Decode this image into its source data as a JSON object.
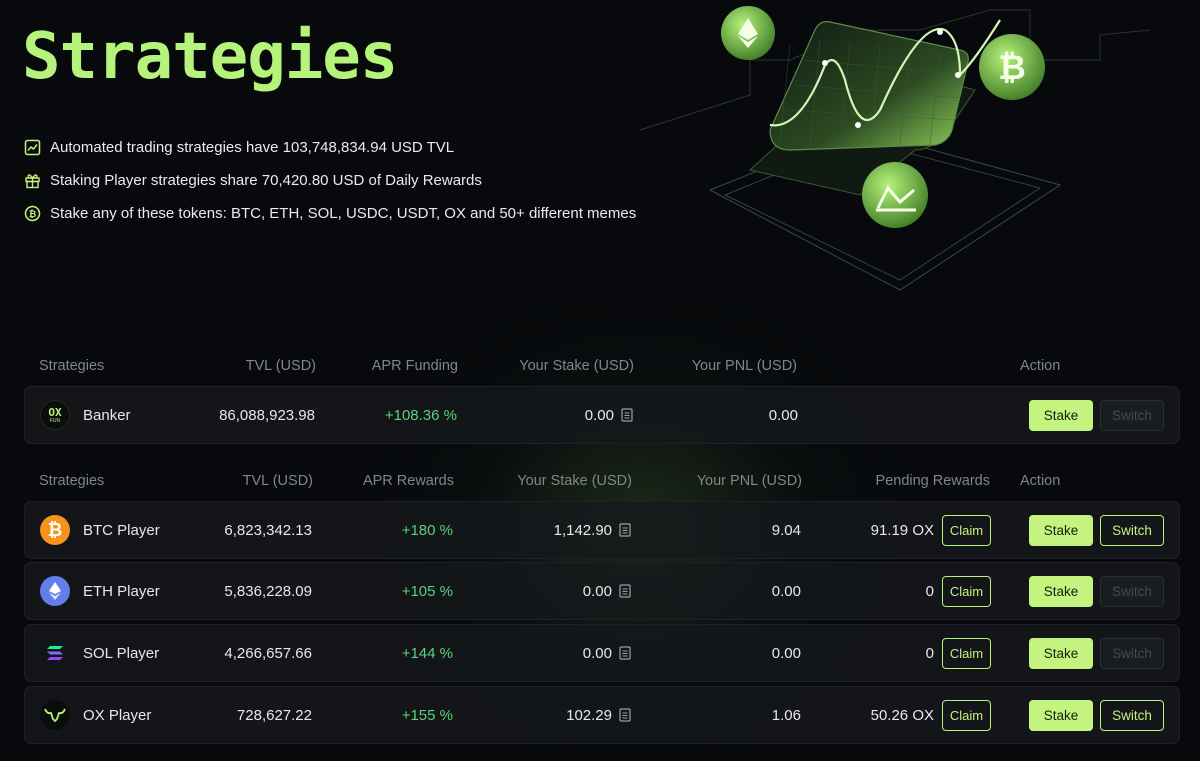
{
  "hero": {
    "title": "Strategies",
    "info": [
      {
        "icon": "chart-trend-icon",
        "text": "Automated trading strategies have 103,748,834.94 USD TVL"
      },
      {
        "icon": "gift-icon",
        "text": "Staking Player strategies share 70,420.80 USD of Daily Rewards"
      },
      {
        "icon": "bitcoin-coin-icon",
        "text": "Stake any of these tokens: BTC, ETH, SOL, USDC, USDT, OX and 50+ different memes"
      }
    ]
  },
  "funding_table": {
    "headers": {
      "strategy": "Strategies",
      "tvl": "TVL (USD)",
      "apr": "APR Funding",
      "stake": "Your Stake (USD)",
      "pnl": "Your PNL (USD)",
      "action": "Action"
    },
    "row": {
      "icon": "ox-fun-logo-icon",
      "logo_text": "OX",
      "logo_sub": "FUN",
      "name": "Banker",
      "tvl": "86,088,923.98",
      "apr": "+108.36 %",
      "stake": "0.00",
      "pnl": "0.00",
      "stake_label": "Stake",
      "switch_label": "Switch",
      "switch_enabled": false
    }
  },
  "player_table": {
    "headers": {
      "strategy": "Strategies",
      "tvl": "TVL (USD)",
      "apr": "APR Rewards",
      "stake": "Your Stake (USD)",
      "pnl": "Your PNL (USD)",
      "pending": "Pending Rewards",
      "action": "Action"
    },
    "rows": [
      {
        "icon": "bitcoin-logo-icon",
        "name": "BTC Player",
        "tvl": "6,823,342.13",
        "apr": "+180 %",
        "stake": "1,142.90",
        "pnl": "9.04",
        "pending": "91.19 OX",
        "claim_label": "Claim",
        "stake_label": "Stake",
        "switch_label": "Switch",
        "switch_enabled": true
      },
      {
        "icon": "ethereum-logo-icon",
        "name": "ETH Player",
        "tvl": "5,836,228.09",
        "apr": "+105 %",
        "stake": "0.00",
        "pnl": "0.00",
        "pending": "0",
        "claim_label": "Claim",
        "stake_label": "Stake",
        "switch_label": "Switch",
        "switch_enabled": false
      },
      {
        "icon": "solana-logo-icon",
        "name": "SOL Player",
        "tvl": "4,266,657.66",
        "apr": "+144 %",
        "stake": "0.00",
        "pnl": "0.00",
        "pending": "0",
        "claim_label": "Claim",
        "stake_label": "Stake",
        "switch_label": "Switch",
        "switch_enabled": false
      },
      {
        "icon": "ox-bull-logo-icon",
        "name": "OX Player",
        "tvl": "728,627.22",
        "apr": "+155 %",
        "stake": "102.29",
        "pnl": "1.06",
        "pending": "50.26 OX",
        "claim_label": "Claim",
        "stake_label": "Stake",
        "switch_label": "Switch",
        "switch_enabled": true
      }
    ]
  },
  "colors": {
    "accent": "#b6f37b",
    "button_fill": "#c4f47f",
    "positive": "#5ed07a",
    "muted": "#7f868d",
    "background": "#07090c",
    "bitcoin": "#f7931a",
    "ethereum": "#627eea"
  }
}
